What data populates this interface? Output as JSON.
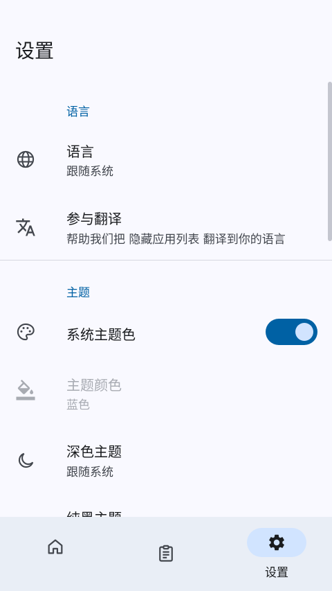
{
  "header": {
    "title": "设置"
  },
  "sections": {
    "language": {
      "header": "语言",
      "items": [
        {
          "title": "语言",
          "subtitle": "跟随系统",
          "icon": "globe-icon"
        },
        {
          "title": "参与翻译",
          "subtitle": "帮助我们把 隐藏应用列表 翻译到你的语言",
          "icon": "translate-icon"
        }
      ]
    },
    "theme": {
      "header": "主题",
      "items": [
        {
          "title": "系统主题色",
          "icon": "palette-icon",
          "switch_on": true
        },
        {
          "title": "主题颜色",
          "subtitle": "蓝色",
          "icon": "paint-bucket-icon",
          "disabled": true
        },
        {
          "title": "深色主题",
          "subtitle": "跟随系统",
          "icon": "moon-icon"
        },
        {
          "title": "纯黑主题"
        }
      ]
    }
  },
  "nav": {
    "items": [
      {
        "label": "",
        "icon": "home-icon",
        "active": false
      },
      {
        "label": "",
        "icon": "clipboard-icon",
        "active": false
      },
      {
        "label": "设置",
        "icon": "gear-icon",
        "active": true
      }
    ]
  },
  "colors": {
    "accent": "#0061a4",
    "accent_container": "#d1e4ff",
    "background": "#f9f9ff",
    "nav_background": "#e9eef6"
  }
}
